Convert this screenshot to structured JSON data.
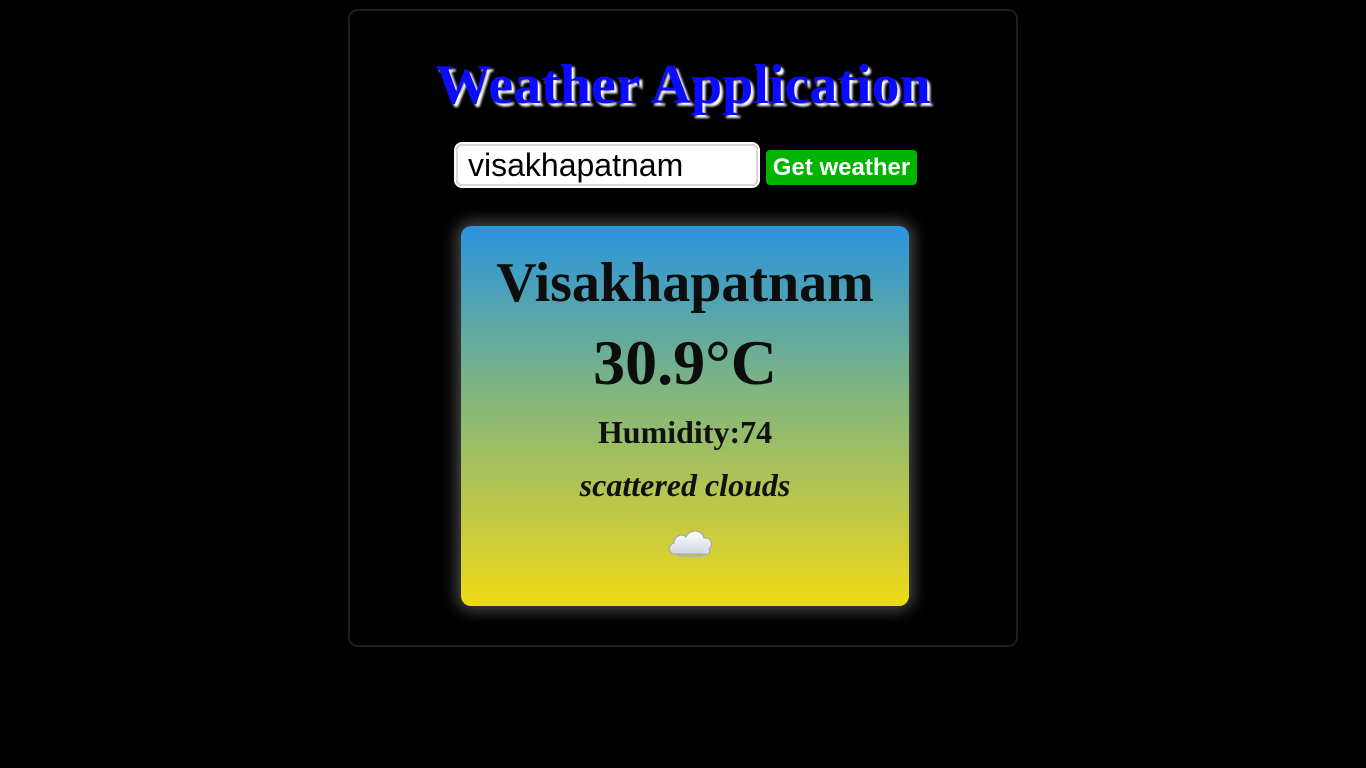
{
  "app": {
    "title": "Weather Application"
  },
  "search": {
    "value": "visakhapatnam",
    "button_label": "Get weather"
  },
  "weather": {
    "city": "Visakhapatnam",
    "temperature": "30.9°C",
    "humidity": "Humidity:74",
    "description": "scattered clouds",
    "icon": "cloud-icon"
  },
  "colors": {
    "title": "#0b0bff",
    "button": "#00b400",
    "card_gradient_top": "#2a94de",
    "card_gradient_bottom": "#efdb14"
  }
}
